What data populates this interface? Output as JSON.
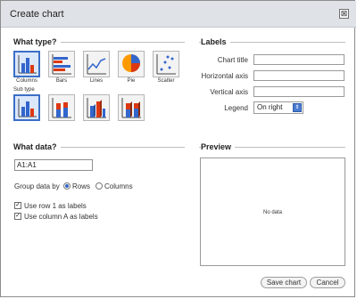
{
  "dialog": {
    "title": "Create chart",
    "close_glyph": "⊠"
  },
  "what_type": {
    "heading": "What type?",
    "types": [
      {
        "label": "Columns",
        "icon": "column-chart-icon",
        "selected": true
      },
      {
        "label": "Bars",
        "icon": "bar-chart-icon",
        "selected": false
      },
      {
        "label": "Lines",
        "icon": "line-chart-icon",
        "selected": false
      },
      {
        "label": "Pie",
        "icon": "pie-chart-icon",
        "selected": false
      },
      {
        "label": "Scatter",
        "icon": "scatter-chart-icon",
        "selected": false
      }
    ],
    "subtype_label": "Sub type",
    "subtypes": [
      {
        "icon": "clustered-column-icon",
        "selected": true
      },
      {
        "icon": "stacked-column-icon",
        "selected": false
      },
      {
        "icon": "3d-column-icon",
        "selected": false
      },
      {
        "icon": "3d-stacked-column-icon",
        "selected": false
      }
    ]
  },
  "labels": {
    "heading": "Labels",
    "chart_title": "Chart title",
    "horizontal_axis": "Horizontal axis",
    "vertical_axis": "Vertical axis",
    "legend": "Legend",
    "legend_value": "On right",
    "legend_arrow": "⇕"
  },
  "what_data": {
    "heading": "What data?",
    "range_value": "A1:A1",
    "group_by_label": "Group data by",
    "group_rows": "Rows",
    "group_columns": "Columns",
    "group_selected": "Rows",
    "use_row_label": "Use row 1 as labels",
    "use_col_label": "Use column A as labels",
    "check_glyph": "✓"
  },
  "preview": {
    "heading": "Preview",
    "no_data": "No data"
  },
  "buttons": {
    "save": "Save chart",
    "cancel": "Cancel"
  },
  "colors": {
    "accent": "#3b6fc6",
    "blue_series": "#3366cc",
    "red_series": "#dc3912",
    "orange_series": "#ff9900"
  }
}
